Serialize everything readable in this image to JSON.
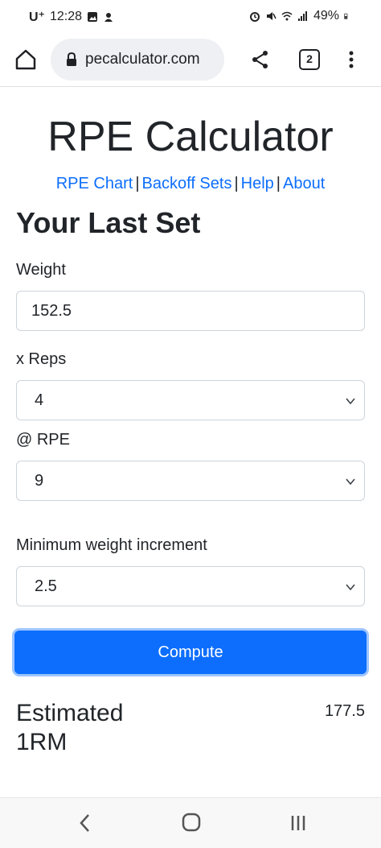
{
  "status_bar": {
    "carrier": "U⁺",
    "time": "12:28",
    "battery": "49%"
  },
  "browser": {
    "url": "pecalculator.com",
    "tab_count": "2"
  },
  "page": {
    "title": "RPE Calculator",
    "nav": {
      "rpe_chart": "RPE Chart",
      "backoff_sets": "Backoff Sets",
      "help": "Help",
      "about": "About",
      "separator": "|"
    },
    "section_title": "Your Last Set"
  },
  "form": {
    "weight_label": "Weight",
    "weight_value": "152.5",
    "reps_label": "x Reps",
    "reps_value": "4",
    "rpe_label": "@ RPE",
    "rpe_value": "9",
    "increment_label": "Minimum weight increment",
    "increment_value": "2.5",
    "compute_label": "Compute"
  },
  "result": {
    "label": "Estimated 1RM",
    "value": "177.5"
  },
  "colors": {
    "primary": "#0d6efd",
    "link": "#0d6efd",
    "text": "#212529"
  }
}
